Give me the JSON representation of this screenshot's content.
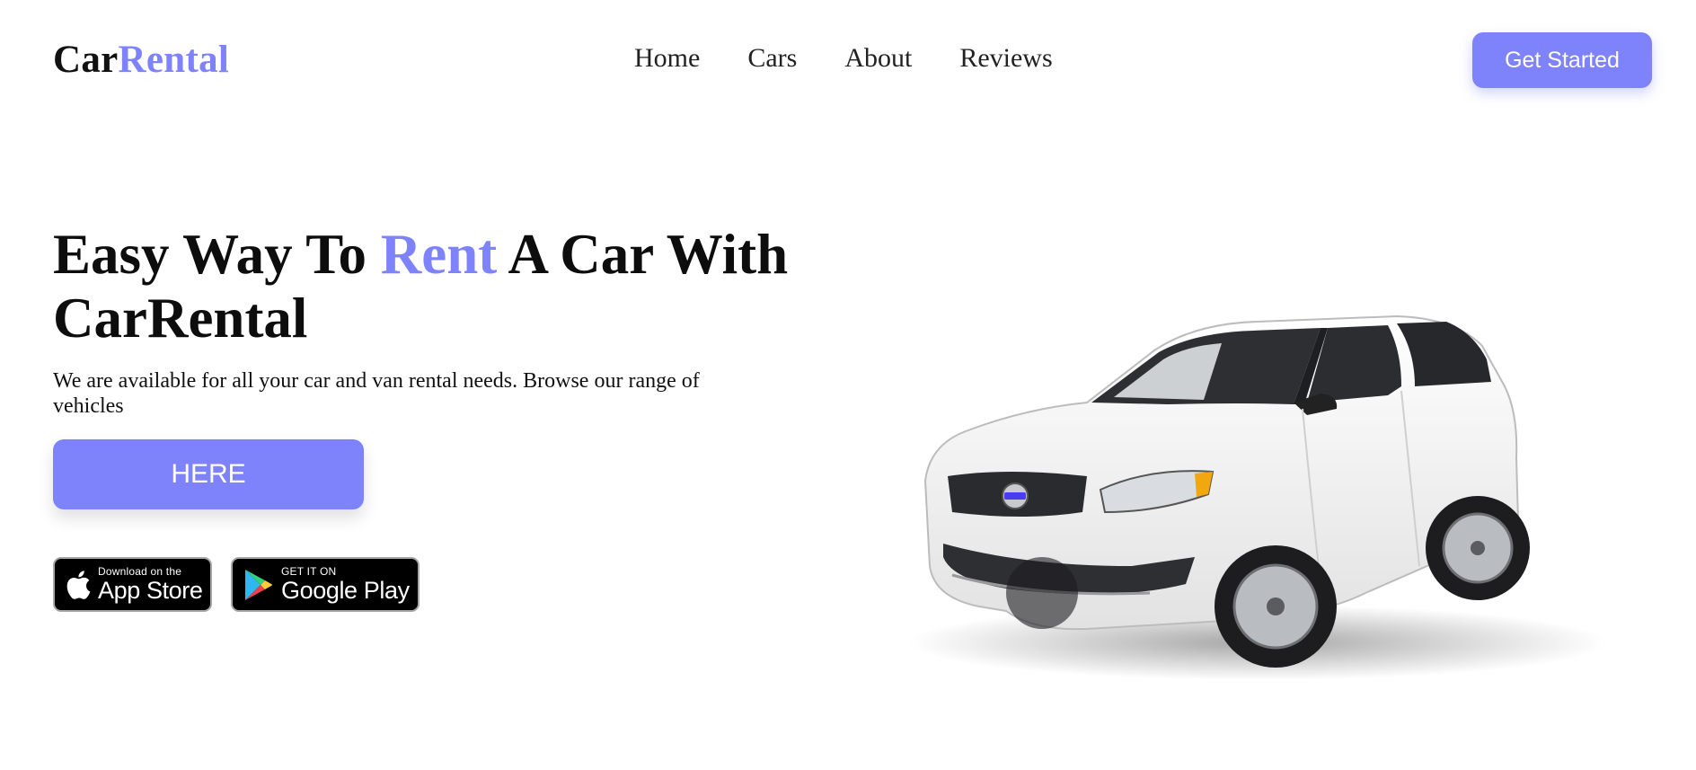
{
  "brand": {
    "part1": "Car",
    "part2": "Rental"
  },
  "nav": [
    {
      "label": "Home"
    },
    {
      "label": "Cars"
    },
    {
      "label": "About"
    },
    {
      "label": "Reviews"
    }
  ],
  "header": {
    "cta_label": "Get Started"
  },
  "hero": {
    "title_pre": "Easy Way To ",
    "title_accent": "Rent",
    "title_post": " A Car With CarRental",
    "subtitle": "We are available for all your car and van rental needs. Browse our range of vehicles",
    "button_label": "HERE"
  },
  "stores": {
    "apple": {
      "small": "Download on the",
      "big": "App Store",
      "icon": "apple-icon"
    },
    "google": {
      "small": "GET IT ON",
      "big": "Google Play",
      "icon": "play-triangle-icon"
    }
  },
  "image": {
    "icon": "car-image"
  },
  "colors": {
    "accent": "#7f83fb",
    "text": "#111111",
    "background": "#ffffff"
  }
}
